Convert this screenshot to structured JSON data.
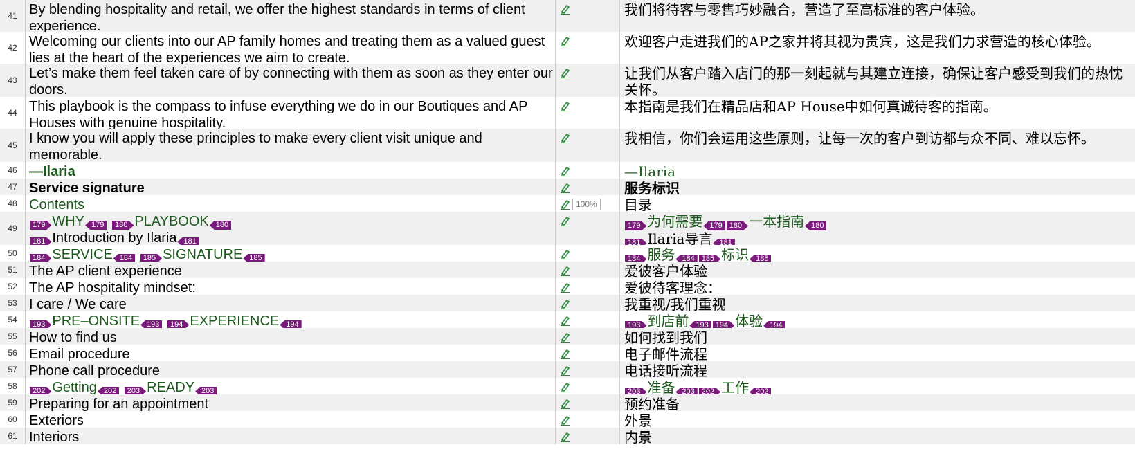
{
  "segments": [
    {
      "num": "41",
      "src": [
        {
          "t": "By blending hospitality and retail, we offer the highest standards in terms of client experience."
        }
      ],
      "tgt": [
        {
          "t": "我们将待客与零售巧妙融合，营造了至高标准的客户体验。"
        }
      ]
    },
    {
      "num": "42",
      "src": [
        {
          "t": "Welcoming our clients into our AP family homes and treating them as a valued guest lies at the heart of the experiences we aim to create."
        }
      ],
      "tgt": [
        {
          "t": "欢迎客户走进我们的AP之家并将其视为贵宾，这是我们力求营造的核心体验。"
        }
      ]
    },
    {
      "num": "43",
      "src": [
        {
          "t": "Let’s make them feel taken care of by connecting with them as soon as they enter our doors."
        }
      ],
      "tgt": [
        {
          "t": "让我们从客户踏入店门的那一刻起就与其建立连接，确保让客户感受到我们的热忱关怀。"
        }
      ]
    },
    {
      "num": "44",
      "src": [
        {
          "t": "This playbook is the compass to infuse everything we do in our Boutiques and AP Houses with genuine hospitality."
        }
      ],
      "tgt": [
        {
          "t": "本指南是我们在精品店和AP House中如何真诚待客的指南。"
        }
      ]
    },
    {
      "num": "45",
      "src": [
        {
          "t": "I know you will apply these principles to make every client visit unique and memorable."
        }
      ],
      "tgt": [
        {
          "t": "我相信，你们会运用这些原则，让每一次的客户到访都与众不同、难以忘怀。"
        }
      ]
    },
    {
      "num": "46",
      "src": [
        {
          "t": "—Ilaria",
          "cls": "green bold"
        }
      ],
      "tgt": [
        {
          "t": "—Ilaria",
          "cls": "green"
        }
      ]
    },
    {
      "num": "47",
      "src": [
        {
          "t": "Service signature",
          "cls": "bold"
        }
      ],
      "tgt": [
        {
          "t": "服务标识",
          "cls": "bold"
        }
      ]
    },
    {
      "num": "48",
      "match": "100%",
      "src": [
        {
          "t": "Contents",
          "cls": "green"
        }
      ],
      "tgt": [
        {
          "t": "目录"
        }
      ]
    },
    {
      "num": "49",
      "src": [
        {
          "tag": "179",
          "dir": "open"
        },
        {
          "t": "WHY",
          "cls": "green"
        },
        {
          "tag": "179",
          "dir": "close"
        },
        {
          "t": " "
        },
        {
          "tag": "180",
          "dir": "open"
        },
        {
          "t": "PLAYBOOK",
          "cls": "green"
        },
        {
          "tag": "180",
          "dir": "close"
        },
        {
          "br": true
        },
        {
          "tag": "181",
          "dir": "open"
        },
        {
          "t": "Introduction by Ilaria"
        },
        {
          "tag": "181",
          "dir": "close"
        }
      ],
      "tgt": [
        {
          "tag": "179",
          "dir": "open"
        },
        {
          "t": "为何需要",
          "cls": "green"
        },
        {
          "tag": "179",
          "dir": "close"
        },
        {
          "tag": "180",
          "dir": "open"
        },
        {
          "t": "一本指南",
          "cls": "green"
        },
        {
          "tag": "180",
          "dir": "close"
        },
        {
          "br": true
        },
        {
          "tag": "181",
          "dir": "open"
        },
        {
          "t": "Ilaria导言"
        },
        {
          "tag": "181",
          "dir": "close"
        }
      ]
    },
    {
      "num": "50",
      "src": [
        {
          "tag": "184",
          "dir": "open"
        },
        {
          "t": "SERVICE",
          "cls": "green"
        },
        {
          "tag": "184",
          "dir": "close"
        },
        {
          "t": " "
        },
        {
          "tag": "185",
          "dir": "open"
        },
        {
          "t": "SIGNATURE",
          "cls": "green"
        },
        {
          "tag": "185",
          "dir": "close"
        }
      ],
      "tgt": [
        {
          "tag": "184",
          "dir": "open"
        },
        {
          "t": "服务",
          "cls": "green"
        },
        {
          "tag": "184",
          "dir": "close"
        },
        {
          "tag": "185",
          "dir": "open"
        },
        {
          "t": "标识",
          "cls": "green"
        },
        {
          "tag": "185",
          "dir": "close"
        }
      ]
    },
    {
      "num": "51",
      "src": [
        {
          "t": "The AP client experience"
        }
      ],
      "tgt": [
        {
          "t": "爱彼客户体验"
        }
      ]
    },
    {
      "num": "52",
      "src": [
        {
          "t": "The AP hospitality mindset:"
        }
      ],
      "tgt": [
        {
          "t": "爱彼待客理念："
        }
      ]
    },
    {
      "num": "53",
      "src": [
        {
          "t": "I care / We care"
        }
      ],
      "tgt": [
        {
          "t": "我重视/我们重视"
        }
      ]
    },
    {
      "num": "54",
      "src": [
        {
          "tag": "193",
          "dir": "open"
        },
        {
          "t": "PRE–ONSITE",
          "cls": "green"
        },
        {
          "tag": "193",
          "dir": "close"
        },
        {
          "t": " "
        },
        {
          "tag": "194",
          "dir": "open"
        },
        {
          "t": "EXPERIENCE",
          "cls": "green"
        },
        {
          "tag": "194",
          "dir": "close"
        }
      ],
      "tgt": [
        {
          "tag": "193",
          "dir": "open"
        },
        {
          "t": "到店前",
          "cls": "green"
        },
        {
          "tag": "193",
          "dir": "close"
        },
        {
          "tag": "194",
          "dir": "open"
        },
        {
          "t": "体验",
          "cls": "green"
        },
        {
          "tag": "194",
          "dir": "close"
        }
      ]
    },
    {
      "num": "55",
      "src": [
        {
          "t": "How to find us"
        }
      ],
      "tgt": [
        {
          "t": "如何找到我们"
        }
      ]
    },
    {
      "num": "56",
      "src": [
        {
          "t": "Email procedure"
        }
      ],
      "tgt": [
        {
          "t": "电子邮件流程"
        }
      ]
    },
    {
      "num": "57",
      "src": [
        {
          "t": "Phone call procedure"
        }
      ],
      "tgt": [
        {
          "t": "电话接听流程"
        }
      ]
    },
    {
      "num": "58",
      "src": [
        {
          "tag": "202",
          "dir": "open"
        },
        {
          "t": "Getting",
          "cls": "green"
        },
        {
          "tag": "202",
          "dir": "close"
        },
        {
          "t": " "
        },
        {
          "tag": "203",
          "dir": "open"
        },
        {
          "t": "READY",
          "cls": "green"
        },
        {
          "tag": "203",
          "dir": "close"
        }
      ],
      "tgt": [
        {
          "tag": "203",
          "dir": "open"
        },
        {
          "t": "准备",
          "cls": "green"
        },
        {
          "tag": "203",
          "dir": "close"
        },
        {
          "tag": "202",
          "dir": "open"
        },
        {
          "t": "工作",
          "cls": "green"
        },
        {
          "tag": "202",
          "dir": "close"
        }
      ]
    },
    {
      "num": "59",
      "src": [
        {
          "t": "Preparing for an appointment"
        }
      ],
      "tgt": [
        {
          "t": "预约准备"
        }
      ]
    },
    {
      "num": "60",
      "src": [
        {
          "t": "Exteriors"
        }
      ],
      "tgt": [
        {
          "t": "外景"
        }
      ]
    },
    {
      "num": "61",
      "src": [
        {
          "t": "Interiors"
        }
      ],
      "tgt": [
        {
          "t": "内景"
        }
      ]
    }
  ],
  "colors": {
    "tag": "#7a1b7c",
    "green_text": "#1d5a1d",
    "pencil": "#2e8b3d",
    "row_alt": "#f0f0f0"
  },
  "icons": {
    "status": "pencil-edit-icon"
  }
}
